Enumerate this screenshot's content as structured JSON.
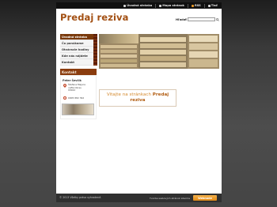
{
  "topbar": {
    "links": [
      {
        "icon": "home-icon",
        "label": "Úvodná stránka"
      },
      {
        "icon": "sitemap-icon",
        "label": "Mapa stránok"
      },
      {
        "icon": "rss-icon",
        "label": "RSS"
      },
      {
        "icon": "print-icon",
        "label": "Tlač"
      }
    ]
  },
  "header": {
    "title": "Predaj reziva",
    "search_label": "Hľadať",
    "search_placeholder": ""
  },
  "nav": {
    "items": [
      {
        "label": "Úvodná stránka",
        "active": true
      },
      {
        "label": "Čo ponúkame",
        "active": false
      },
      {
        "label": "Otváracie hodiny",
        "active": false
      },
      {
        "label": "Kde nás nájdete",
        "active": false
      },
      {
        "label": "Kontakt",
        "active": false
      }
    ]
  },
  "contact": {
    "heading": "Kontakt",
    "name": "Peter Ševčík",
    "address_lines": [
      "Štefana Majera",
      "nafta Okres",
      "93022"
    ],
    "phone": "0905 882 392"
  },
  "welcome": {
    "prefix": "Vitajte na stránkach ",
    "highlight": "Predaj reziva"
  },
  "footer": {
    "copyright": "© 2013 Všetky práva vyhradené.",
    "note": "Tvorba webových stránok zdarma",
    "button": "Webnode"
  },
  "colors": {
    "accent": "#a24f12",
    "nav_active": "#7a3a0c",
    "welcome": "#d48a2f",
    "footer_button": "#e08a17"
  }
}
